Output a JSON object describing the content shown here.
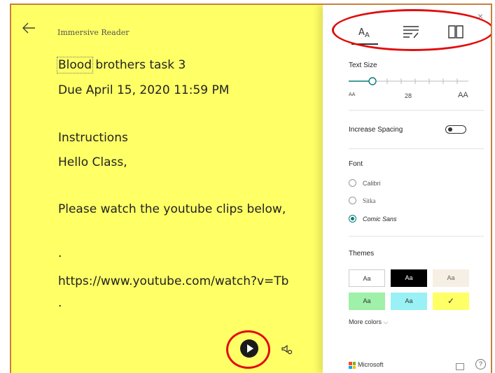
{
  "reader": {
    "title": "Immersive Reader",
    "lines": [
      "Blood",
      " brothers task 3",
      "Due April 15, 2020 11:59 PM",
      "Instructions",
      "Hello Class,",
      "Please watch the youtube clips below,",
      ".",
      "https://www.youtube.com/watch?v=Tb",
      "."
    ]
  },
  "panel": {
    "tabs": [
      "text-preferences",
      "grammar-options",
      "reading-preferences"
    ],
    "close": "×",
    "text_size_label": "Text Size",
    "text_size_small": "AA",
    "text_size_value": "28",
    "text_size_large": "AA",
    "text_size_level": 0.2,
    "increase_spacing_label": "Increase Spacing",
    "increase_spacing_on": false,
    "font_label": "Font",
    "fonts": [
      "Calibri",
      "Sitka",
      "Comic Sans"
    ],
    "selected_font": "Comic Sans",
    "themes_label": "Themes",
    "themes": [
      {
        "label": "Aa",
        "bg": "#ffffff",
        "fg": "#333333"
      },
      {
        "label": "Aa",
        "bg": "#000000",
        "fg": "#ffffff"
      },
      {
        "label": "Aa",
        "bg": "#f6efe3",
        "fg": "#666666"
      },
      {
        "label": "Aa",
        "bg": "#9ff0a9",
        "fg": "#333333"
      },
      {
        "label": "Aa",
        "bg": "#99f1f5",
        "fg": "#333333"
      },
      {
        "label": "✓",
        "bg": "#ffff66",
        "fg": "#333333"
      }
    ],
    "more_colors": "More colors",
    "brand": "Microsoft",
    "help": "?"
  },
  "colors": {
    "reader_bg": "#ffff66",
    "accent": "#0a7a79",
    "annotation": "#e10d0d",
    "frame": "#c87f3c"
  }
}
